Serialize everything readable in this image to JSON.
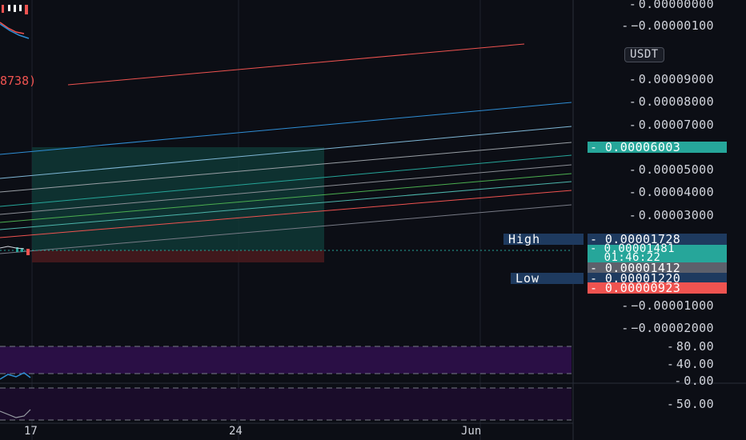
{
  "price_axis": {
    "ticks": [
      "0.00000000",
      "−0.00000100",
      "0.00009000",
      "0.00008000",
      "0.00007000",
      "0.00005000",
      "0.00004000",
      "0.00003000",
      "−0.00001000",
      "−0.00002000"
    ],
    "currency_button": "USDT"
  },
  "price_tags": {
    "current": "0.00006003",
    "high_value": "0.00001728",
    "last_price": "0.00001481",
    "countdown": "01:46:22",
    "mid_value": "0.00001412",
    "low_value": "0.00001220",
    "red_value": "0.00000923"
  },
  "labels": {
    "high": "High",
    "low": "Low",
    "overlay_fragment": "8738)"
  },
  "oscillator_1": {
    "ticks": [
      "80.00",
      "40.00",
      "0.00"
    ]
  },
  "oscillator_2": {
    "ticks": [
      "50.00"
    ]
  },
  "time_axis": {
    "ticks": [
      "17",
      "24",
      "Jun"
    ]
  },
  "colors": {
    "background": "#0c0e15",
    "teal": "#26a69a",
    "red": "#ef5350",
    "blue_label": "#1e3a5f",
    "purple_pane": "#2a0f45"
  }
}
